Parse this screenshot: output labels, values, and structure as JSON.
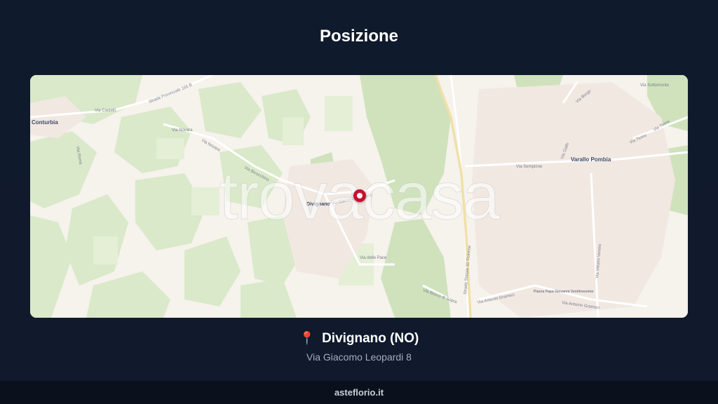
{
  "page": {
    "title": "Posizione"
  },
  "map": {
    "watermark": "trovacasa",
    "labels": {
      "town_center": "Divignano",
      "town_west": "Conturbia",
      "town_east": "Varallo Pombia"
    },
    "roads": [
      "Via Castelli",
      "Strada Provinciale 166 B",
      "Via Novara",
      "Via Novara",
      "Via Bicocchina",
      "Via Giacomo Leopardi",
      "Via Roma",
      "Via Sempione",
      "Via Ticino",
      "Via Ticino",
      "Via Sottomonte",
      "Via Borgo",
      "Strada Statale 32 Ticinese",
      "Via Antonio Gramsci",
      "Via Antonio Gramsci",
      "Via Vittorio Veneto",
      "Via Bosco di Sopra",
      "Via delle Pace",
      "Via Gallo",
      "Piazza Papa Giovanni Ventitreesimo"
    ],
    "marker_icon": "map-marker-icon"
  },
  "location": {
    "icon": "pin-icon",
    "name": "Divignano (NO)",
    "address": "Via Giacomo Leopardi 8"
  },
  "footer": {
    "site": "asteflorio.it"
  },
  "colors": {
    "background": "#0f1a2d",
    "footer_bg": "#0b111c",
    "marker": "#c8102e",
    "pin_icon": "#e8506a",
    "map_green": "#d8e8c8",
    "map_urban": "#f6f1ec"
  }
}
